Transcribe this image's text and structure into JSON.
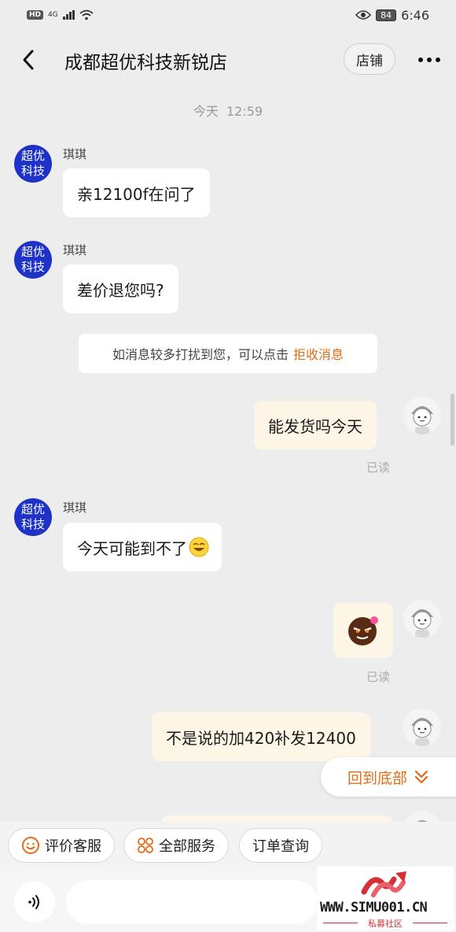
{
  "status_bar": {
    "hd": "HD",
    "network": "4G",
    "battery": "84",
    "time": "6:46"
  },
  "header": {
    "title": "成都超优科技新锐店",
    "shop_button": "店铺"
  },
  "chat": {
    "date_label": "今天",
    "time_label": "12:59",
    "shop_avatar_line1": "超优",
    "shop_avatar_line2": "科技",
    "messages": [
      {
        "sender": "琪琪",
        "text": "亲12100f在问了"
      },
      {
        "sender": "琪琪",
        "text": "差价退您吗?"
      },
      {
        "text": "能发货吗今天",
        "status": "已读"
      },
      {
        "sender": "琪琪",
        "text": "今天可能到不了"
      },
      {
        "status": "已读"
      },
      {
        "text": "不是说的加420补发12400"
      }
    ],
    "notice_text": "如消息较多打扰到您，可以点击",
    "notice_link": "拒收消息",
    "back_to_bottom": "回到底部"
  },
  "quick_actions": [
    {
      "label": "评价客服",
      "icon": "smiley-icon"
    },
    {
      "label": "全部服务",
      "icon": "grid-icon"
    },
    {
      "label": "订单查询",
      "icon": ""
    }
  ],
  "input": {
    "placeholder": ""
  },
  "watermark": {
    "url": "WWW.SIMU001.CN",
    "subtitle": "私募社区"
  },
  "colors": {
    "accent": "#e06d1a",
    "shop_avatar": "#1e32c8",
    "user_bubble": "#fdf6e6",
    "background": "#ededed"
  }
}
